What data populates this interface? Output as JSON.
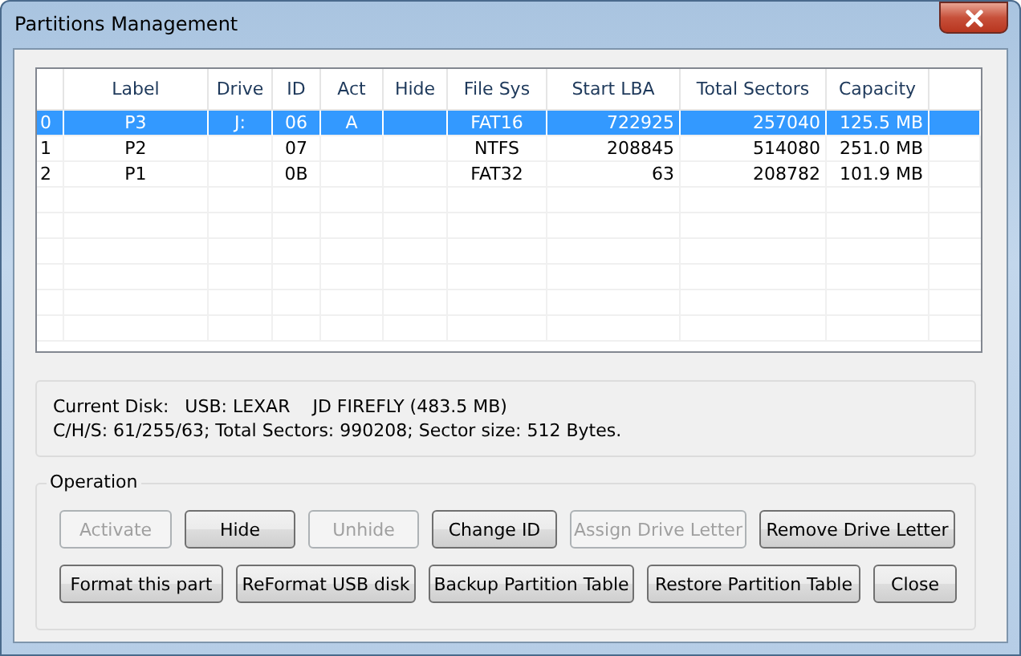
{
  "window": {
    "title": "Partitions Management"
  },
  "table": {
    "columns": [
      "Label",
      "Drive",
      "ID",
      "Act",
      "Hide",
      "File Sys",
      "Start LBA",
      "Total Sectors",
      "Capacity"
    ],
    "rows": [
      {
        "index": "0",
        "selected": true,
        "cells": [
          "P3",
          "J:",
          "06",
          "A",
          "",
          "FAT16",
          "722925",
          "257040",
          "125.5 MB"
        ]
      },
      {
        "index": "1",
        "selected": false,
        "cells": [
          "P2",
          "",
          "07",
          "",
          "",
          "NTFS",
          "208845",
          "514080",
          "251.0 MB"
        ]
      },
      {
        "index": "2",
        "selected": false,
        "cells": [
          "P1",
          "",
          "0B",
          "",
          "",
          "FAT32",
          "63",
          "208782",
          "101.9 MB"
        ]
      }
    ]
  },
  "disk_info": {
    "current_disk_label": "Current Disk:",
    "current_disk": "USB: LEXAR    JD FIREFLY (483.5 MB)",
    "geometry": "C/H/S: 61/255/63; Total Sectors: 990208; Sector size: 512 Bytes."
  },
  "operation": {
    "title": "Operation",
    "button_rows": [
      [
        {
          "label": "Activate",
          "disabled": true
        },
        {
          "label": "Hide",
          "disabled": false
        },
        {
          "label": "Unhide",
          "disabled": true
        },
        {
          "label": "Change ID",
          "disabled": false
        },
        {
          "label": "Assign Drive Letter",
          "disabled": true
        },
        {
          "label": "Remove Drive Letter",
          "disabled": false
        }
      ],
      [
        {
          "label": "Format this part",
          "disabled": false
        },
        {
          "label": "ReFormat USB disk",
          "disabled": false
        },
        {
          "label": "Backup Partition Table",
          "disabled": false
        },
        {
          "label": "Restore Partition Table",
          "disabled": false
        },
        {
          "label": "Close",
          "disabled": false
        }
      ]
    ]
  }
}
